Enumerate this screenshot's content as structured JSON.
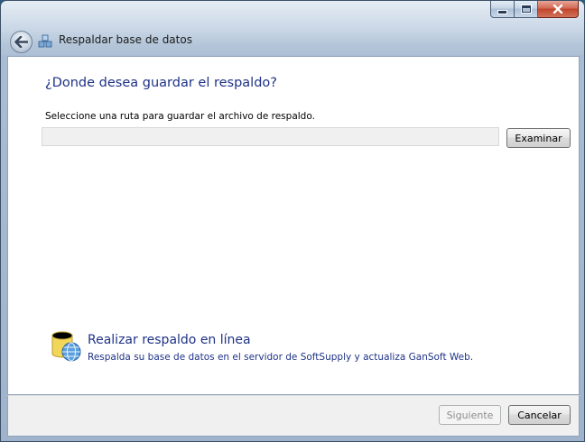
{
  "window": {
    "title": "Respaldar base de datos",
    "controls": [
      "minimize",
      "maximize",
      "close"
    ]
  },
  "header": {
    "back_icon": "back-arrow-icon",
    "wizard_icon": "database-backup-icon"
  },
  "main": {
    "heading": "¿Donde desea guardar el respaldo?",
    "instruction": "Seleccione una ruta para guardar el archivo de respaldo.",
    "path_input": {
      "value": "",
      "placeholder": ""
    },
    "browse_label": "Examinar"
  },
  "online_backup": {
    "icon": "database-globe-icon",
    "title": "Realizar respaldo en línea",
    "description": "Respalda su base de datos en el servidor de SoftSupply y actualiza GanSoft Web."
  },
  "footer": {
    "next_label": "Siguiente",
    "next_enabled": false,
    "cancel_label": "Cancelar"
  },
  "colors": {
    "heading": "#1e3287",
    "link": "#1e3287",
    "close_button": "#c0452b",
    "content_background": "#ffffff",
    "footer_background": "#f0f0f0"
  }
}
